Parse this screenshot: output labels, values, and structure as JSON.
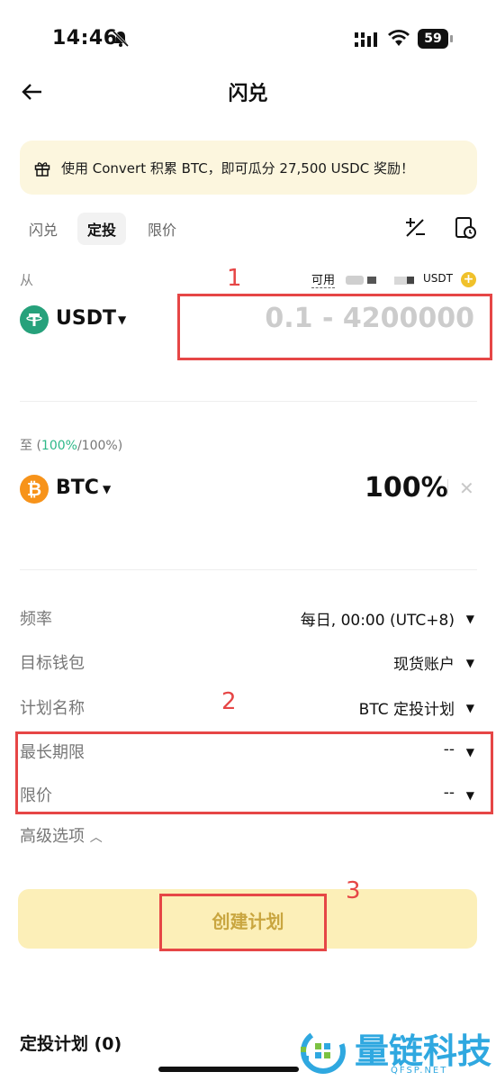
{
  "status_bar": {
    "time": "14:46",
    "battery": "59"
  },
  "header": {
    "title": "闪兑"
  },
  "banner": {
    "text": "使用 Convert 积累 BTC，即可瓜分 27,500 USDC 奖励！"
  },
  "tabs": [
    {
      "label": "闪兑",
      "active": false
    },
    {
      "label": "定投",
      "active": true
    },
    {
      "label": "限价",
      "active": false
    }
  ],
  "from": {
    "label": "从",
    "available_label": "可用",
    "available_currency": "USDT",
    "coin": "USDT",
    "amount_placeholder": "0.1 - 4200000"
  },
  "to": {
    "label_prefix": "至 (",
    "pct_green": "100%",
    "label_suffix": "/100%)",
    "coin": "BTC",
    "percent": "100%"
  },
  "settings": [
    {
      "label": "频率",
      "value": "每日, 00:00 (UTC+8)"
    },
    {
      "label": "目标钱包",
      "value": "现货账户"
    },
    {
      "label": "计划名称",
      "value": "BTC 定投计划"
    },
    {
      "label": "最长期限",
      "value": "--"
    },
    {
      "label": "限价",
      "value": "--"
    }
  ],
  "advanced": "高级选项",
  "create_button": "创建计划",
  "plans_heading": "定投计划 (0)",
  "annotations": [
    "1",
    "2",
    "3"
  ],
  "watermark": {
    "text": "量链科技",
    "sub": "QFSP.NET"
  },
  "colors": {
    "accent_yellow": "#fcefb8",
    "tether_green": "#26a17b",
    "btc_orange": "#f7931a",
    "annotation_red": "#e64646"
  }
}
